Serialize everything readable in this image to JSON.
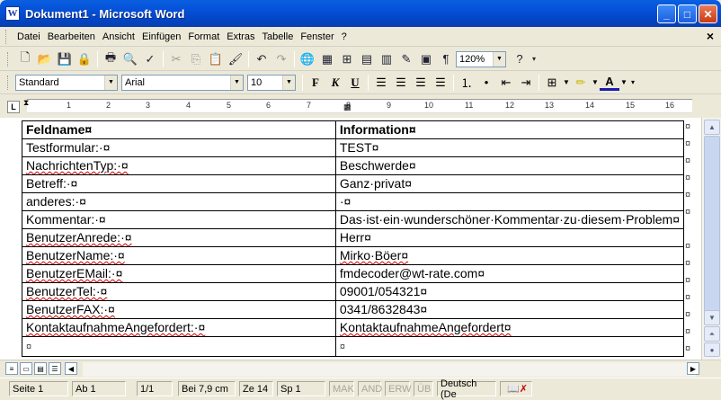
{
  "window": {
    "title": "Dokument1 - Microsoft Word",
    "app_icon_letter": "W"
  },
  "menu": {
    "items": [
      "Datei",
      "Bearbeiten",
      "Ansicht",
      "Einfügen",
      "Format",
      "Extras",
      "Tabelle",
      "Fenster",
      "?"
    ],
    "close_doc": "×"
  },
  "toolbar": {
    "zoom": "120%",
    "style": "Standard",
    "font": "Arial",
    "size": "10"
  },
  "ruler": {
    "labels": [
      "1",
      "2",
      "3",
      "4",
      "5",
      "6",
      "7",
      "8",
      "9",
      "10",
      "11",
      "12",
      "13",
      "14",
      "15",
      "16"
    ]
  },
  "table": {
    "header": {
      "field": "Feldname¤",
      "info": "Information¤"
    },
    "rows": [
      {
        "field": "Testformular:·¤",
        "info": "TEST¤",
        "squig_field": false,
        "squig_info": false
      },
      {
        "field": "NachrichtenTyp:·¤",
        "info": "Beschwerde¤",
        "squig_field": true,
        "squig_info": false
      },
      {
        "field": "Betreff:·¤",
        "info": "Ganz·privat¤",
        "squig_field": false,
        "squig_info": false
      },
      {
        "field": "anderes:·¤",
        "info": "·¤",
        "squig_field": false,
        "squig_info": false
      },
      {
        "field": "Kommentar:·¤",
        "info": "Das·ist·ein·wunderschöner·Kommentar·zu·diesem·Problem¤",
        "squig_field": false,
        "squig_info": false
      },
      {
        "field": "BenutzerAnrede:·¤",
        "info": "Herr¤",
        "squig_field": true,
        "squig_info": false
      },
      {
        "field": "BenutzerName:·¤",
        "info": "Mirko·Böer¤",
        "squig_field": true,
        "squig_info": true
      },
      {
        "field": "BenutzerEMail:·¤",
        "info": "fmdecoder@wt-rate.com¤",
        "squig_field": true,
        "squig_info": false
      },
      {
        "field": "BenutzerTel:·¤",
        "info": "09001/054321¤",
        "squig_field": true,
        "squig_info": false
      },
      {
        "field": "BenutzerFAX:·¤",
        "info": "0341/8632843¤",
        "squig_field": true,
        "squig_info": false
      },
      {
        "field": "KontaktaufnahmeAngefordert:·¤",
        "info": "KontaktaufnahmeAngefordert¤",
        "squig_field": true,
        "squig_info": true
      },
      {
        "field": "¤",
        "info": "¤",
        "squig_field": false,
        "squig_info": false
      }
    ],
    "end_mark": "¤"
  },
  "status": {
    "page": "Seite 1",
    "section": "Ab 1",
    "pages": "1/1",
    "at": "Bei 7,9 cm",
    "line": "Ze 14",
    "col": "Sp 1",
    "rec": "MAK",
    "trk": "AND",
    "ext": "ERW",
    "ovr": "ÜB",
    "lang": "Deutsch (De"
  }
}
